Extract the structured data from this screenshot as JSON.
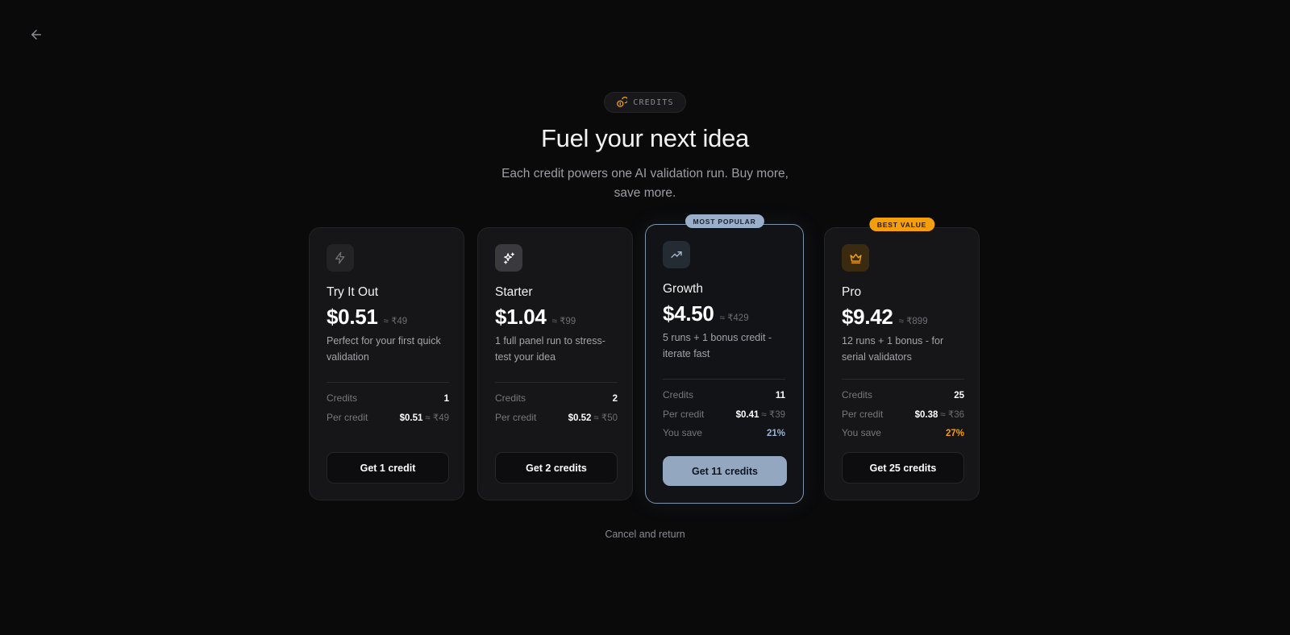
{
  "header": {
    "badge_label": "CREDITS",
    "title": "Fuel your next idea",
    "subtitle": "Each credit powers one AI validation run. Buy more, save more."
  },
  "plans": [
    {
      "name": "Try It Out",
      "icon": "bolt-icon",
      "price": "$0.51",
      "price_inr": "≈ ₹49",
      "description": "Perfect for your first quick validation",
      "credits_label": "Credits",
      "credits": "1",
      "per_credit_label": "Per credit",
      "per_credit": "$0.51",
      "per_credit_inr": "≈ ₹49",
      "cta": "Get 1 credit"
    },
    {
      "name": "Starter",
      "icon": "sparkles-icon",
      "price": "$1.04",
      "price_inr": "≈ ₹99",
      "description": "1 full panel run to stress-test your idea",
      "credits_label": "Credits",
      "credits": "2",
      "per_credit_label": "Per credit",
      "per_credit": "$0.52",
      "per_credit_inr": "≈ ₹50",
      "cta": "Get 2 credits"
    },
    {
      "name": "Growth",
      "tag": "MOST POPULAR",
      "icon": "trending-up-icon",
      "price": "$4.50",
      "price_inr": "≈ ₹429",
      "description": "5 runs + 1 bonus credit - iterate fast",
      "credits_label": "Credits",
      "credits": "11",
      "per_credit_label": "Per credit",
      "per_credit": "$0.41",
      "per_credit_inr": "≈ ₹39",
      "save_label": "You save",
      "save": "21%",
      "cta": "Get 11 credits",
      "accent": "#94a7c0"
    },
    {
      "name": "Pro",
      "tag": "BEST VALUE",
      "icon": "crown-icon",
      "price": "$9.42",
      "price_inr": "≈ ₹899",
      "description": "12 runs + 1 bonus - for serial validators",
      "credits_label": "Credits",
      "credits": "25",
      "per_credit_label": "Per credit",
      "per_credit": "$0.38",
      "per_credit_inr": "≈ ₹36",
      "save_label": "You save",
      "save": "27%",
      "cta": "Get 25 credits",
      "accent": "#f59e0b"
    }
  ],
  "footer": {
    "cancel_label": "Cancel and return"
  }
}
